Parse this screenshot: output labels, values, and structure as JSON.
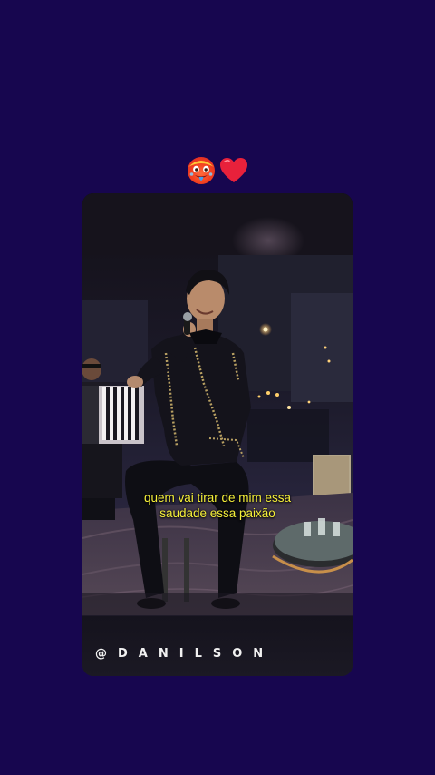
{
  "reactions": [
    {
      "icon": "hot-face-emoji",
      "label": "hot face"
    },
    {
      "icon": "red-heart-emoji",
      "label": "heart"
    }
  ],
  "video": {
    "caption_lines": [
      "quem vai tirar de mim essa",
      "saudade essa paixão"
    ],
    "caption_color": "#f6f03a",
    "watermark": "@DANILSON"
  },
  "colors": {
    "background": "#17064f",
    "heart": "#e8213b"
  }
}
